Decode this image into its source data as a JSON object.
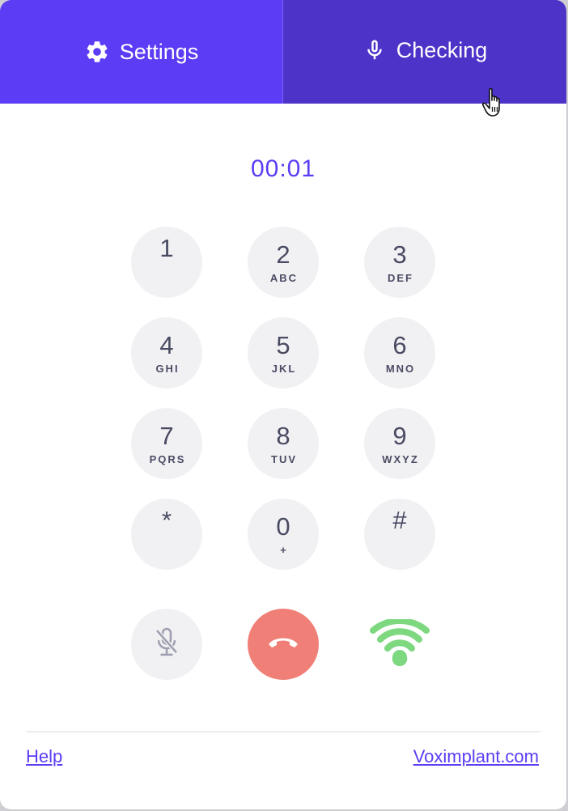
{
  "tabs": {
    "settings_label": "Settings",
    "checking_label": "Checking",
    "settings_icon": "gear-icon",
    "checking_icon": "microphone-icon"
  },
  "timer": "00:01",
  "keypad": [
    {
      "digit": "1",
      "letters": ""
    },
    {
      "digit": "2",
      "letters": "ABC"
    },
    {
      "digit": "3",
      "letters": "DEF"
    },
    {
      "digit": "4",
      "letters": "GHI"
    },
    {
      "digit": "5",
      "letters": "JKL"
    },
    {
      "digit": "6",
      "letters": "MNO"
    },
    {
      "digit": "7",
      "letters": "PQRS"
    },
    {
      "digit": "8",
      "letters": "TUV"
    },
    {
      "digit": "9",
      "letters": "WXYZ"
    },
    {
      "digit": "*",
      "letters": ""
    },
    {
      "digit": "0",
      "letters": "+"
    },
    {
      "digit": "#",
      "letters": ""
    }
  ],
  "controls": {
    "mute_icon": "microphone-muted-icon",
    "hangup_icon": "phone-hangup-icon",
    "signal_icon": "wifi-signal-icon"
  },
  "footer": {
    "help": "Help",
    "site": "Voximplant.com"
  },
  "colors": {
    "accent": "#5c3cf4",
    "tab_active": "#4e33c9",
    "hangup": "#f07f77",
    "signal": "#7dd87f",
    "key_bg": "#f1f1f4",
    "key_text": "#4a4b63"
  }
}
